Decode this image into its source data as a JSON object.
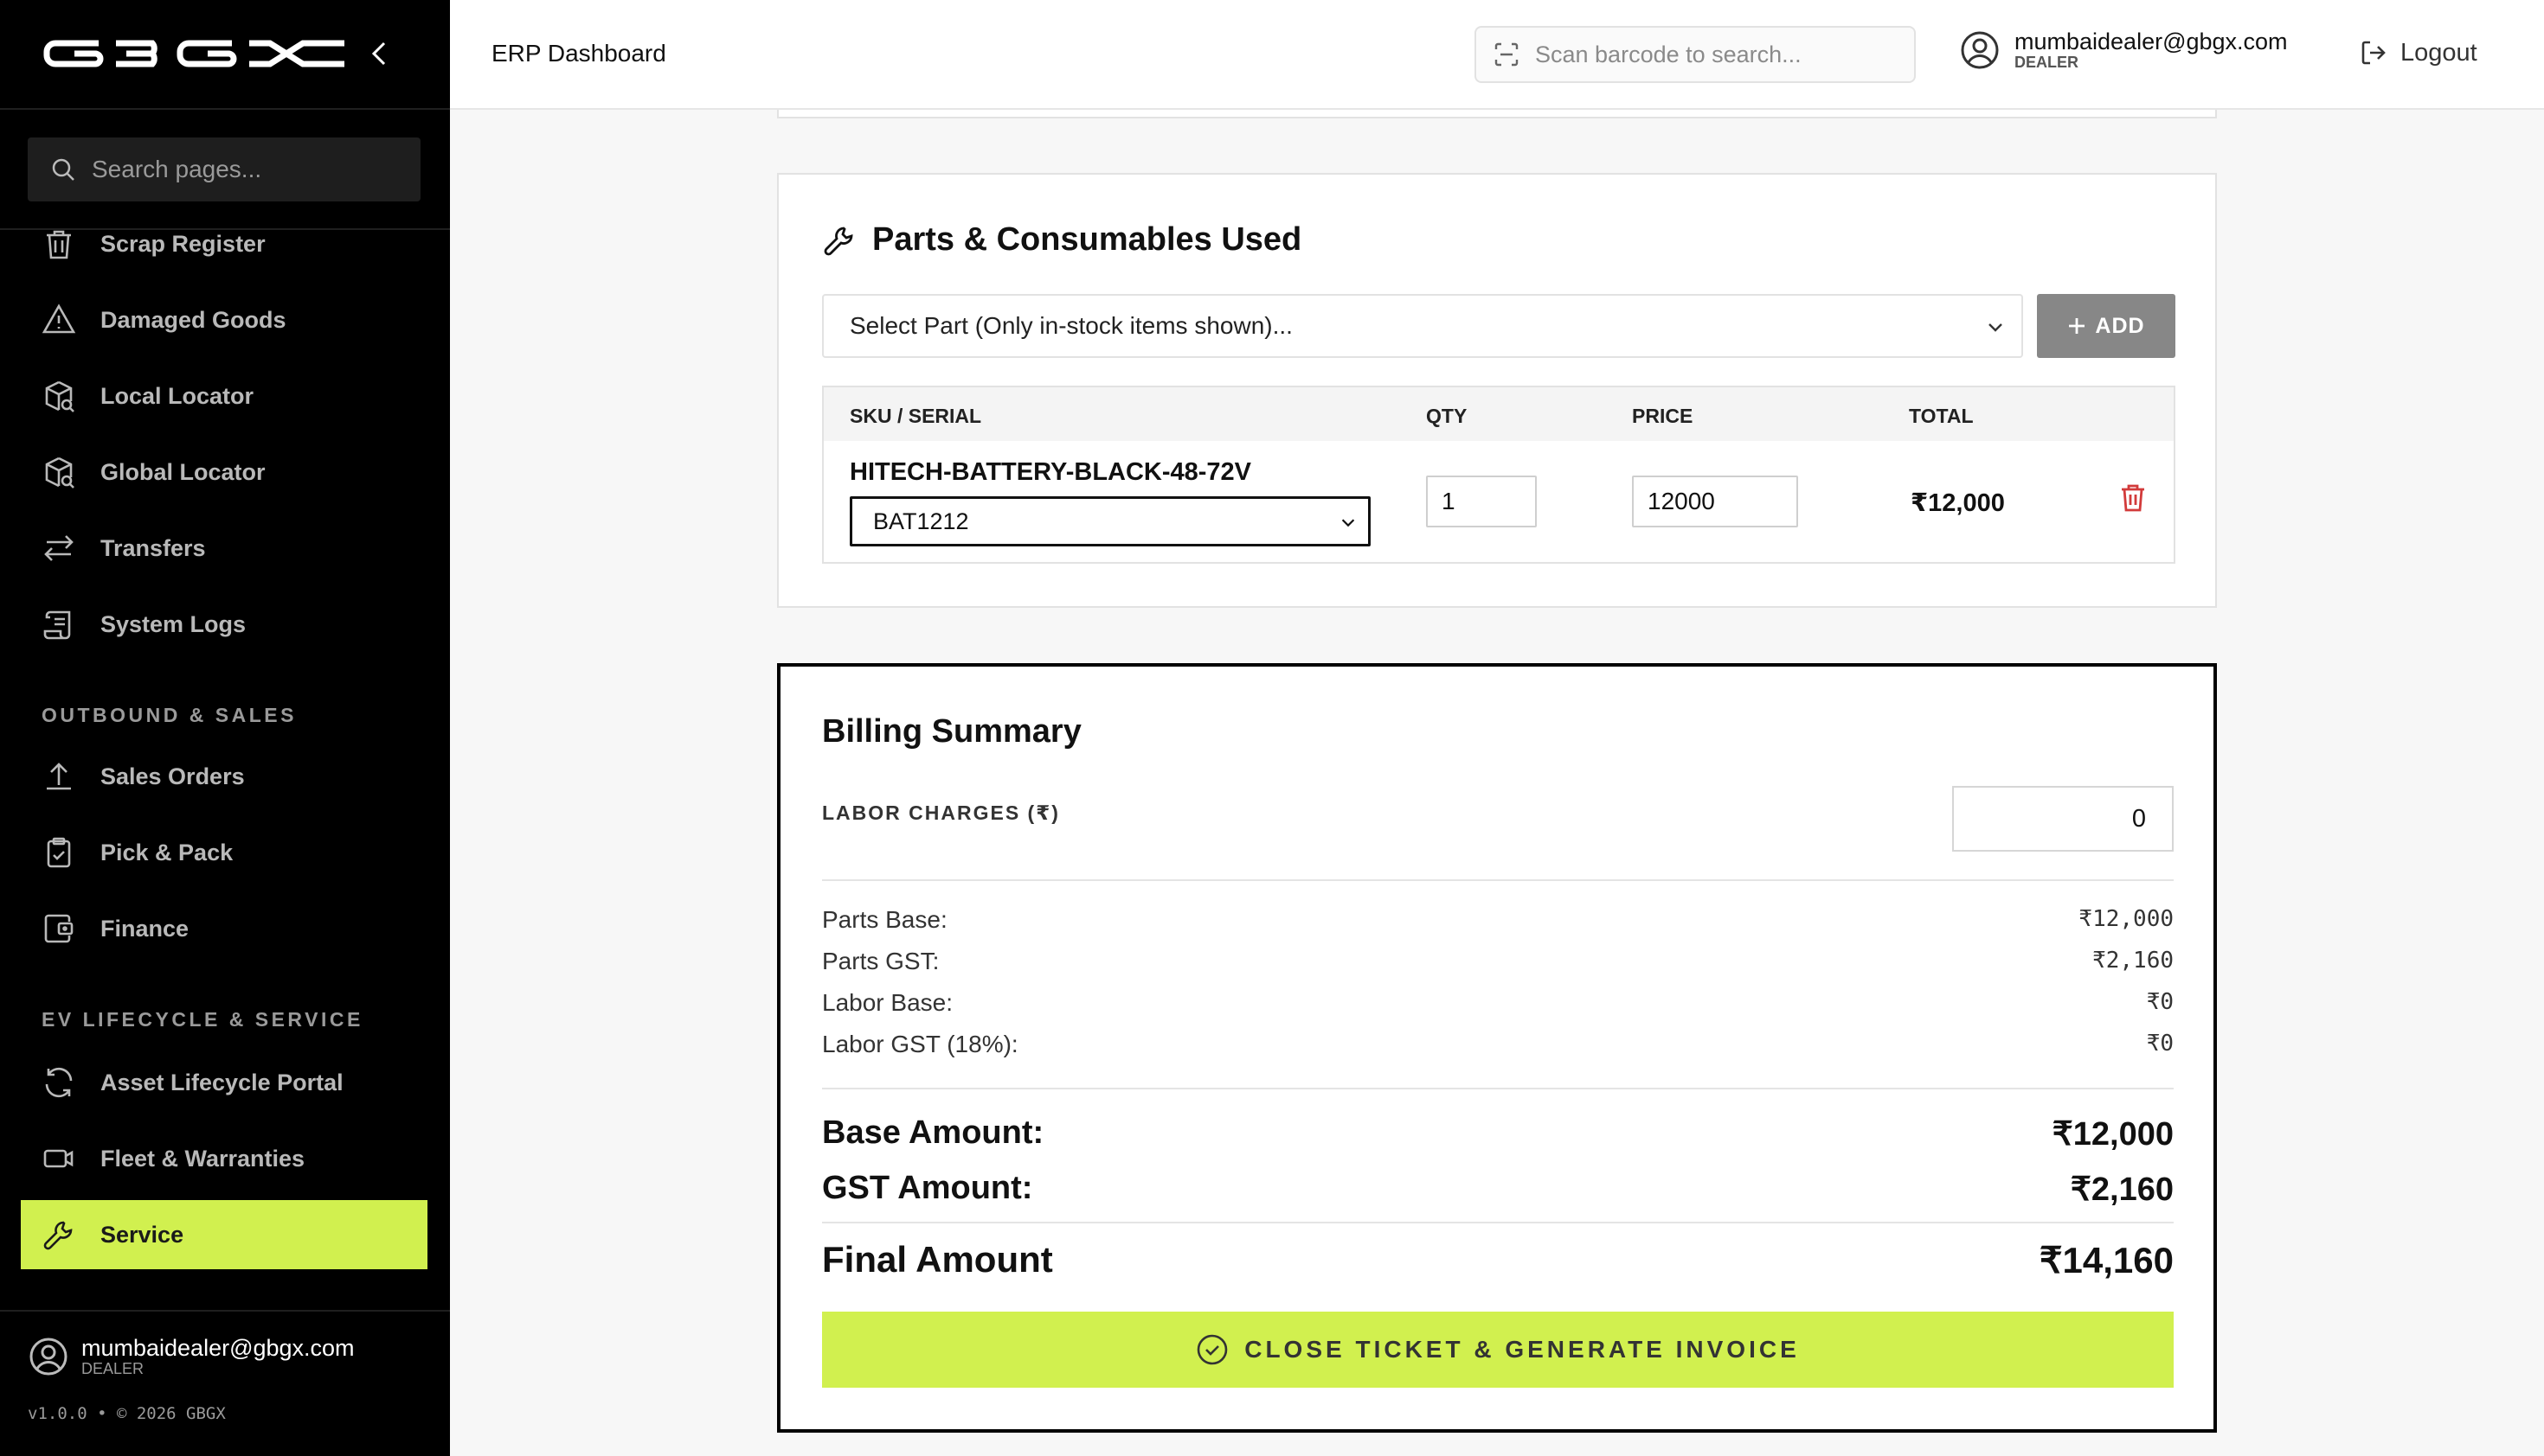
{
  "brand": {
    "logo_text": "GBGX",
    "accent": "#d1f04f"
  },
  "sidebar": {
    "search_placeholder": "Search pages...",
    "items": [
      {
        "label": "Scrap Register",
        "icon": "trash-icon"
      },
      {
        "label": "Damaged Goods",
        "icon": "warning-icon"
      },
      {
        "label": "Local Locator",
        "icon": "box-search-icon"
      },
      {
        "label": "Global Locator",
        "icon": "box-search-icon"
      },
      {
        "label": "Transfers",
        "icon": "arrows-swap-icon"
      },
      {
        "label": "System Logs",
        "icon": "scroll-icon"
      }
    ],
    "sections": [
      {
        "title": "OUTBOUND & SALES",
        "items": [
          {
            "label": "Sales Orders",
            "icon": "upload-icon"
          },
          {
            "label": "Pick & Pack",
            "icon": "clipboard-icon"
          },
          {
            "label": "Finance",
            "icon": "wallet-icon"
          }
        ]
      },
      {
        "title": "EV LIFECYCLE & SERVICE",
        "items": [
          {
            "label": "Asset Lifecycle Portal",
            "icon": "refresh-icon"
          },
          {
            "label": "Fleet & Warranties",
            "icon": "video-icon"
          },
          {
            "label": "Service",
            "icon": "wrench-icon",
            "active": true
          }
        ]
      }
    ],
    "user": {
      "email": "mumbaidealer@gbgx.com",
      "role": "DEALER"
    },
    "version": "v1.0.0 • © 2026 GBGX"
  },
  "header": {
    "title": "ERP Dashboard",
    "barcode_placeholder": "Scan barcode to search...",
    "user": {
      "email": "mumbaidealer@gbgx.com",
      "role": "DEALER"
    },
    "logout_label": "Logout"
  },
  "parts": {
    "title": "Parts & Consumables Used",
    "select_placeholder": "Select Part (Only in-stock items shown)...",
    "add_label": "ADD",
    "columns": [
      "SKU / SERIAL",
      "QTY",
      "PRICE",
      "TOTAL"
    ],
    "rows": [
      {
        "sku": "HITECH-BATTERY-BLACK-48-72V",
        "serial": "BAT1212",
        "qty": "1",
        "price": "12000",
        "total": "₹12,000"
      }
    ]
  },
  "billing": {
    "title": "Billing Summary",
    "labor_label": "LABOR CHARGES (₹)",
    "labor_value": "0",
    "lines": [
      {
        "label": "Parts Base:",
        "value": "₹12,000"
      },
      {
        "label": "Parts GST:",
        "value": "₹2,160"
      },
      {
        "label": "Labor Base:",
        "value": "₹0"
      },
      {
        "label": "Labor GST (18%):",
        "value": "₹0"
      }
    ],
    "base_amount": {
      "label": "Base Amount:",
      "value": "₹12,000"
    },
    "gst_amount": {
      "label": "GST Amount:",
      "value": "₹2,160"
    },
    "final_amount": {
      "label": "Final Amount",
      "value": "₹14,160"
    },
    "close_label": "CLOSE TICKET & GENERATE INVOICE"
  }
}
